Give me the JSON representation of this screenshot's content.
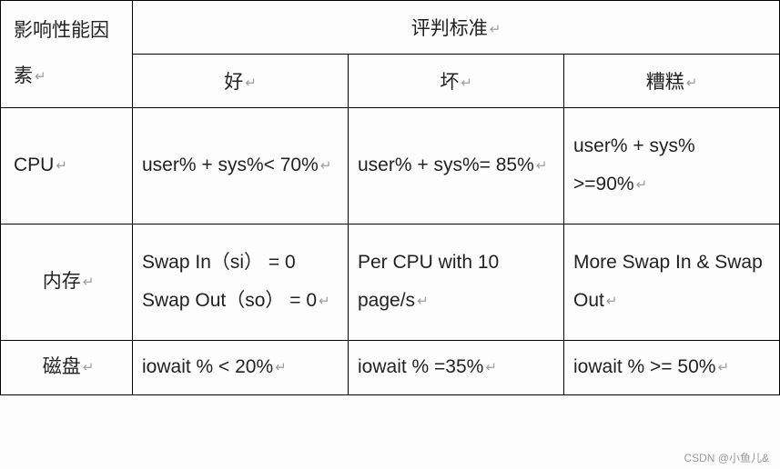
{
  "chart_data": {
    "type": "table",
    "title": "",
    "header_factor": "影响性能因素",
    "header_criteria": "评判标准",
    "sub_headers": [
      "好",
      "坏",
      "糟糕"
    ],
    "rows": [
      {
        "factor": "CPU",
        "good": "user% + sys%< 70%",
        "bad": "user% + sys%= 85%",
        "terrible": "user% + sys% >=90%"
      },
      {
        "factor": "内存",
        "good": "Swap In（si） = 0 Swap Out（so） = 0",
        "bad": "Per CPU with 10 page/s",
        "terrible": "More Swap In & Swap Out"
      },
      {
        "factor": "磁盘",
        "good": "iowait % < 20%",
        "bad": "iowait % =35%",
        "terrible": "iowait % >= 50%"
      }
    ]
  },
  "paragraph_glyph": "↵",
  "watermark": "CSDN @小鱼儿&"
}
